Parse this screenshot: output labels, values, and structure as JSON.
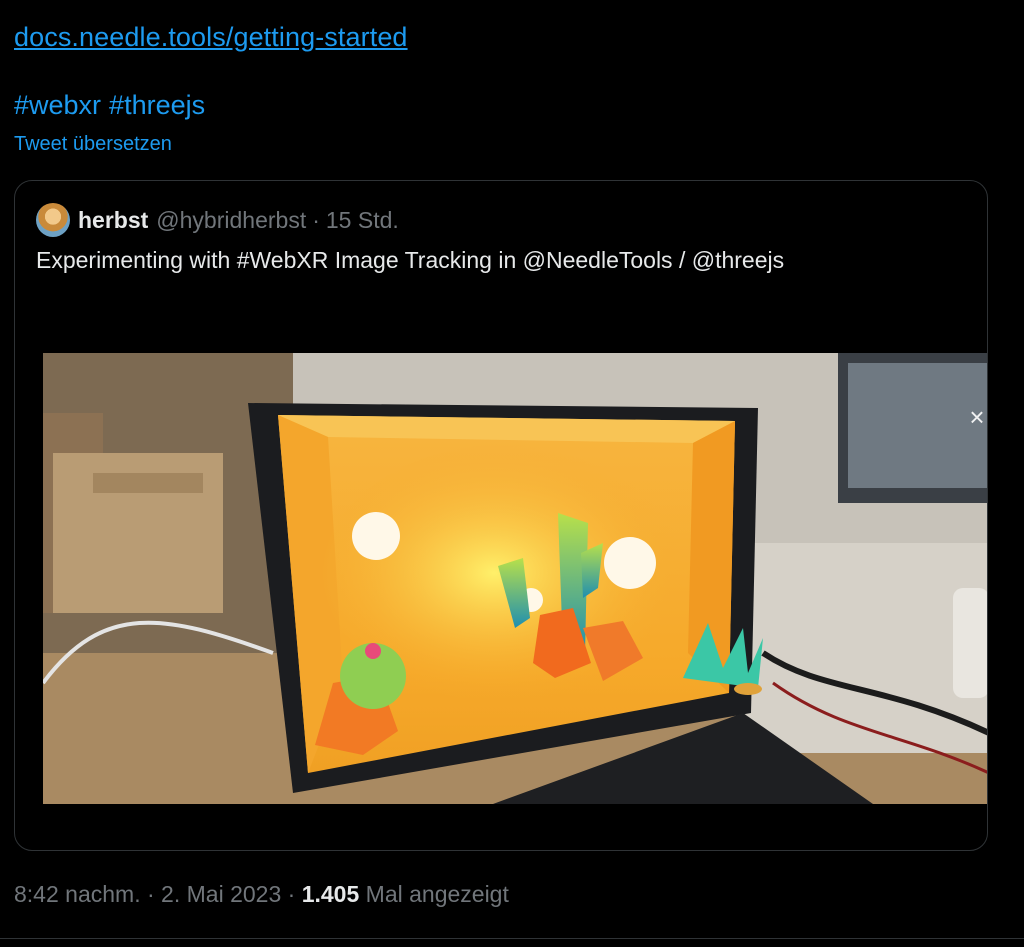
{
  "tweet": {
    "link_text": "docs.needle.tools/getting-started",
    "hashtags": [
      "#webxr",
      "#threejs"
    ],
    "translate_label": "Tweet übersetzen"
  },
  "quoted": {
    "name": "herbst",
    "handle": "@hybridherbst",
    "separator": "·",
    "age": "15 Std.",
    "text": "Experimenting with #WebXR Image Tracking in @NeedleTools / @threejs",
    "media_close_icon": "close-icon"
  },
  "meta": {
    "time": "8:42 nachm.",
    "sep1": "·",
    "date": "2. Mai 2023",
    "sep2": "·",
    "views_count": "1.405",
    "views_label": "Mal angezeigt"
  },
  "colors": {
    "background": "#000000",
    "link": "#1d9bf0",
    "text": "#e7e9ea",
    "muted": "#71767b",
    "border": "#2f3336"
  }
}
